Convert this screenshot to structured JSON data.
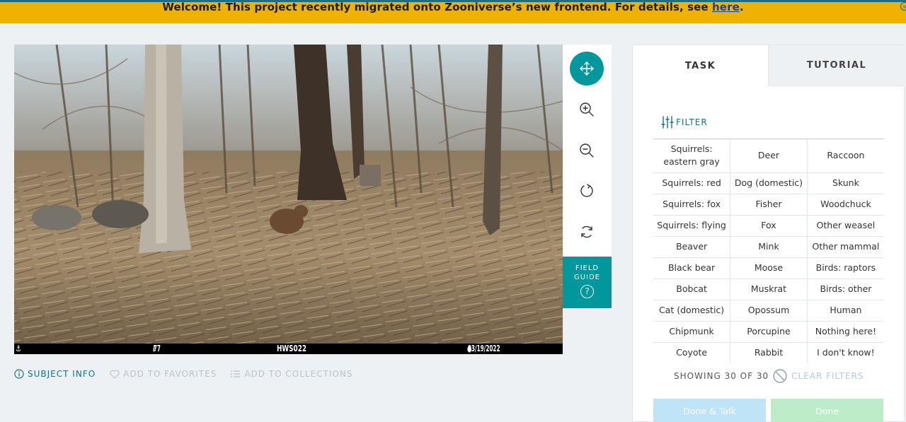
{
  "banner": {
    "text": "Welcome! This project recently migrated onto Zooniverse’s new frontend. For details, see ",
    "link": "here",
    "after": ".",
    "bg": "#f0b200"
  },
  "subject": {
    "image_description_icon": "camera-trap-photo",
    "overlay": {
      "temperature": "77 F",
      "camera": "HWS022",
      "timestamp": "03/19/2022 11:14AM"
    }
  },
  "toolbar": {
    "tools": [
      {
        "name": "move-icon",
        "active": true
      },
      {
        "name": "zoom-in-icon",
        "active": false
      },
      {
        "name": "zoom-out-icon",
        "active": false
      },
      {
        "name": "rotate-icon",
        "active": false
      },
      {
        "name": "reset-icon",
        "active": false
      }
    ],
    "field_guide_line1": "FIELD",
    "field_guide_line2": "GUIDE",
    "field_guide_icon": "?",
    "accent": "#00979d"
  },
  "meta": {
    "subject_info": "SUBJECT INFO",
    "add_favorites": "ADD TO FAVORITES",
    "add_collections": "ADD TO COLLECTIONS"
  },
  "panel": {
    "tabs": [
      {
        "label": "TASK",
        "active": true
      },
      {
        "label": "TUTORIAL",
        "active": false
      }
    ],
    "filter_label": "FILTER",
    "choices": [
      [
        "Squirrels: eastern gray",
        "Deer",
        "Raccoon"
      ],
      [
        "Squirrels: red",
        "Dog (domestic)",
        "Skunk"
      ],
      [
        "Squirrels: fox",
        "Fisher",
        "Woodchuck"
      ],
      [
        "Squirrels: flying",
        "Fox",
        "Other weasel"
      ],
      [
        "Beaver",
        "Mink",
        "Other mammal"
      ],
      [
        "Black bear",
        "Moose",
        "Birds: raptors"
      ],
      [
        "Bobcat",
        "Muskrat",
        "Birds: other"
      ],
      [
        "Cat (domestic)",
        "Opossum",
        "Human"
      ],
      [
        "Chipmunk",
        "Porcupine",
        "Nothing here!"
      ],
      [
        "Coyote",
        "Rabbit",
        "I don't know!"
      ]
    ],
    "showing": "SHOWING 30 OF 30",
    "clear_filters": "CLEAR FILTERS",
    "done_talk": "Done & Talk",
    "done": "Done"
  }
}
